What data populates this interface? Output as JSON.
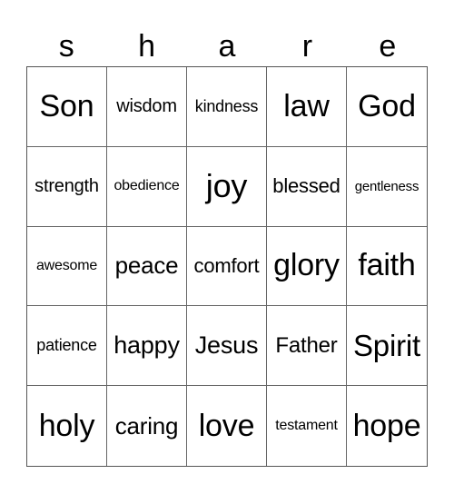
{
  "header": {
    "letters": [
      "s",
      "h",
      "a",
      "r",
      "e"
    ]
  },
  "board": {
    "rows": [
      [
        "Son",
        "wisdom",
        "kindness",
        "law",
        "God"
      ],
      [
        "strength",
        "obedience",
        "joy",
        "blessed",
        "gentleness"
      ],
      [
        "awesome",
        "peace",
        "comfort",
        "glory",
        "faith"
      ],
      [
        "patience",
        "happy",
        "Jesus",
        "Father",
        "Spirit"
      ],
      [
        "holy",
        "caring",
        "love",
        "testament",
        "hope"
      ]
    ]
  }
}
